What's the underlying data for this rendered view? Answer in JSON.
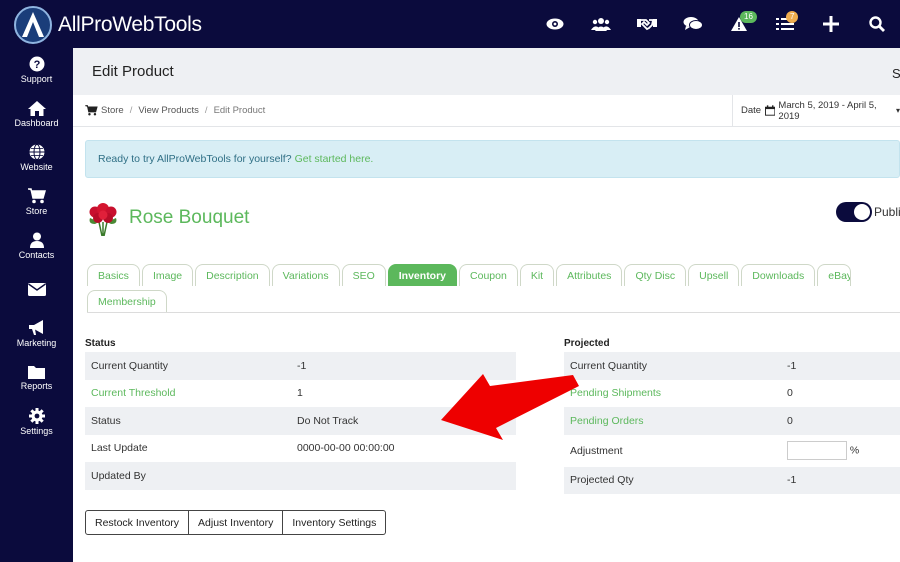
{
  "app": {
    "name": "AllProWebTools"
  },
  "topbar": {
    "icons": [
      "eye-icon",
      "users-icon",
      "handshake-icon",
      "chat-icon",
      "alert-icon",
      "tasks-icon",
      "plus-icon",
      "search-icon"
    ],
    "alerts_badge": "16",
    "tasks_badge": "7"
  },
  "sidebar": {
    "items": [
      {
        "label": "Support",
        "icon": "question-icon"
      },
      {
        "label": "Dashboard",
        "icon": "home-icon"
      },
      {
        "label": "Website",
        "icon": "globe-icon"
      },
      {
        "label": "Store",
        "icon": "cart-icon"
      },
      {
        "label": "Contacts",
        "icon": "person-icon"
      },
      {
        "label": "",
        "icon": "mail-icon"
      },
      {
        "label": "Marketing",
        "icon": "megaphone-icon"
      },
      {
        "label": "Reports",
        "icon": "folder-icon"
      },
      {
        "label": "Settings",
        "icon": "gear-icon"
      }
    ]
  },
  "page": {
    "title": "Edit Product",
    "head_right": "S"
  },
  "breadcrumb": {
    "items": [
      "Store",
      "View Products",
      "Edit Product"
    ]
  },
  "date_range": {
    "label": "Date",
    "value": "March 5, 2019 - April 5, 2019"
  },
  "alert": {
    "text": "Ready to try AllProWebTools for yourself?",
    "link": "Get started here."
  },
  "product": {
    "name": "Rose Bouquet",
    "toggle_label": "Publi"
  },
  "tabs": {
    "row1": [
      "Basics",
      "Image",
      "Description",
      "Variations",
      "SEO",
      "Inventory",
      "Coupon",
      "Kit",
      "Attributes",
      "Qty Disc",
      "Upsell",
      "Downloads",
      "eBay"
    ],
    "row2": [
      "Membership"
    ],
    "active": "Inventory"
  },
  "status": {
    "title": "Status",
    "rows": [
      {
        "label": "Current Quantity",
        "value": "-1"
      },
      {
        "label": "Current Threshold",
        "value": "1"
      },
      {
        "label": "Status",
        "value": "Do Not Track"
      },
      {
        "label": "Last Update",
        "value": "0000-00-00 00:00:00"
      },
      {
        "label": "Updated By",
        "value": ""
      }
    ]
  },
  "projected": {
    "title": "Projected",
    "rows": [
      {
        "label": "Current Quantity",
        "value": "-1"
      },
      {
        "label": "Pending Shipments",
        "value": "0"
      },
      {
        "label": "Pending Orders",
        "value": "0"
      },
      {
        "label": "Adjustment",
        "value": "%"
      },
      {
        "label": "Projected Qty",
        "value": "-1"
      }
    ]
  },
  "buttons": {
    "restock": "Restock Inventory",
    "adjust": "Adjust Inventory",
    "settings": "Inventory Settings"
  },
  "colors": {
    "navy": "#0b0b3d",
    "green": "#5cb85c",
    "arrow": "#ee0000"
  }
}
